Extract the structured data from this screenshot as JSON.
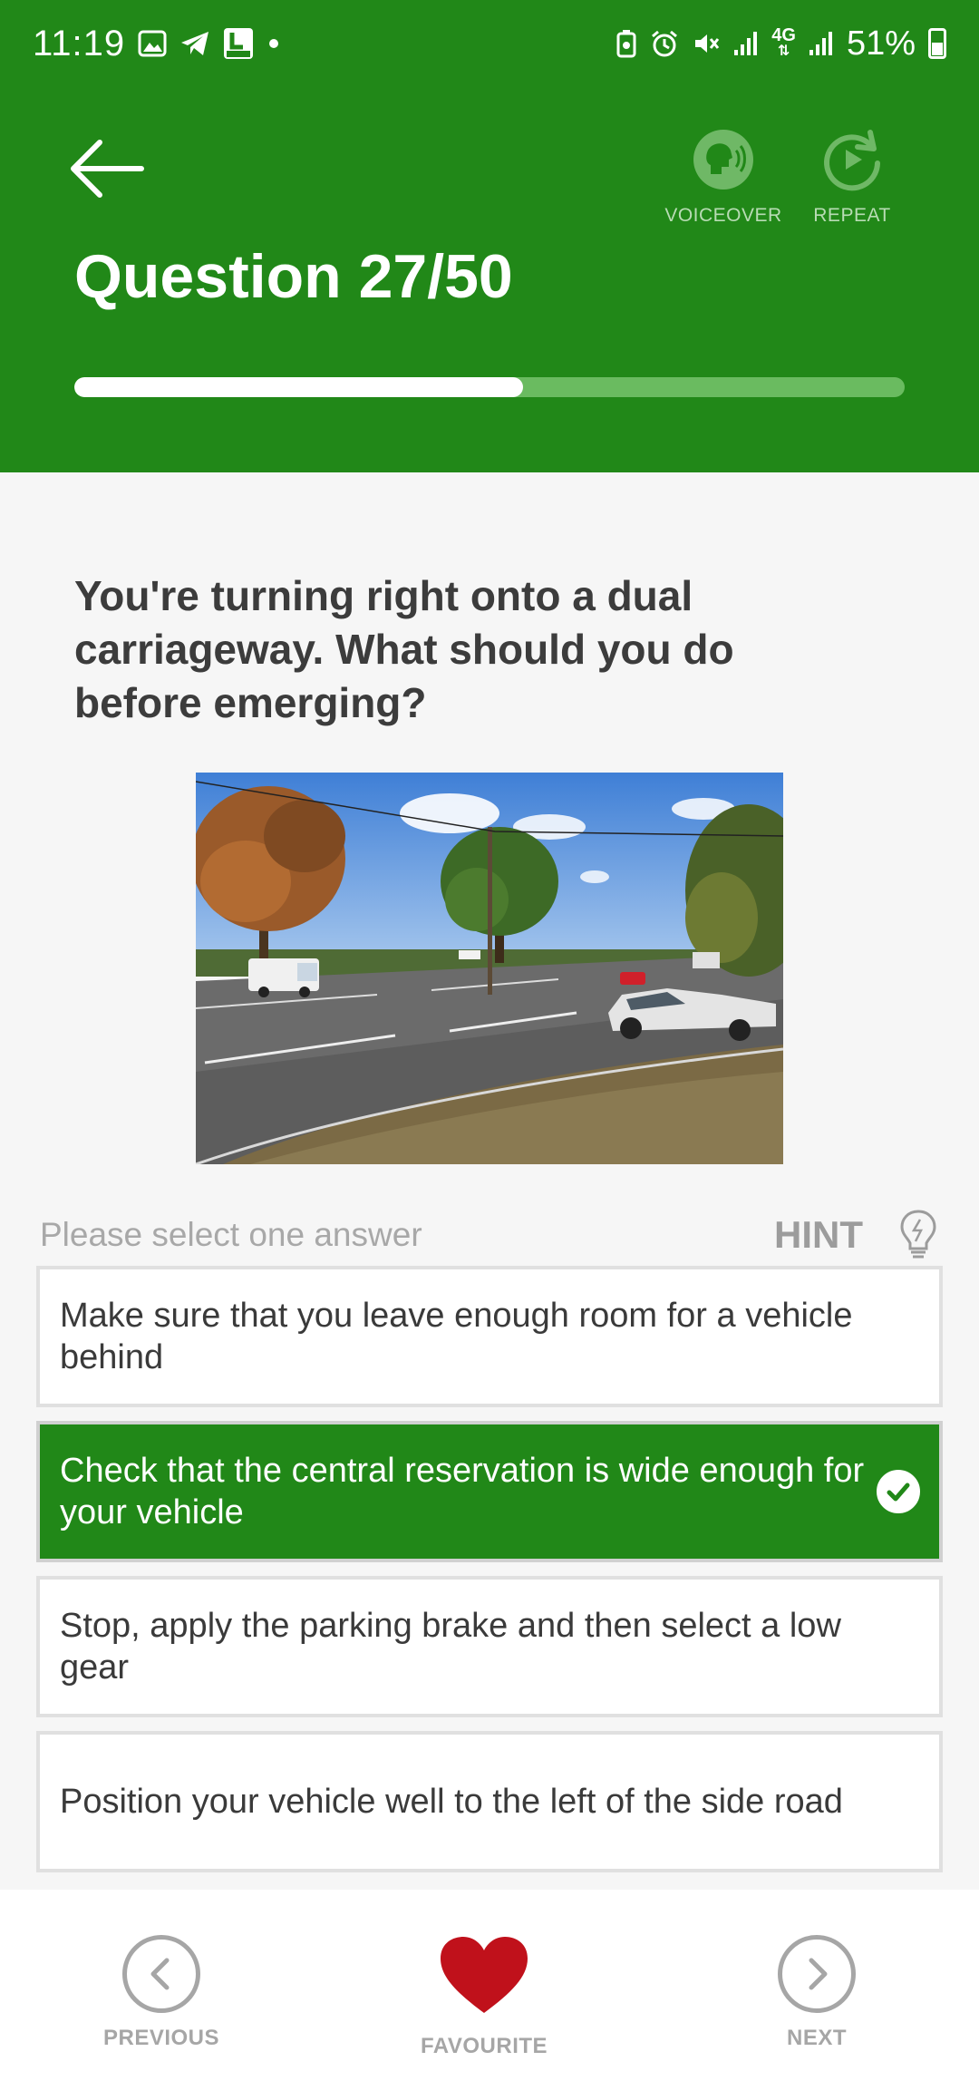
{
  "status_bar": {
    "time": "11:19",
    "network": "4G",
    "battery": "51%"
  },
  "header": {
    "title": "Question 27/50",
    "progress": 0.54,
    "voiceover_label": "VOICEOVER",
    "repeat_label": "REPEAT",
    "bg_color": "#218818"
  },
  "question": {
    "text": "You're turning right onto a dual carriageway. What should you do before emerging?"
  },
  "answers_section": {
    "prompt": "Please select one answer",
    "hint_label": "HINT"
  },
  "answers": [
    {
      "text": "Make sure that you leave enough room for a vehicle behind",
      "selected": false
    },
    {
      "text": "Check that the central reservation is wide enough for your vehicle",
      "selected": true
    },
    {
      "text": "Stop, apply the parking brake and then select a low gear",
      "selected": false
    },
    {
      "text": "Position your vehicle well to the left of the side road",
      "selected": false
    }
  ],
  "bottom_nav": {
    "previous_label": "PREVIOUS",
    "favourite_label": "FAVOURITE",
    "next_label": "NEXT"
  },
  "colors": {
    "primary_green": "#218818",
    "favourite_red": "#c0111b"
  }
}
